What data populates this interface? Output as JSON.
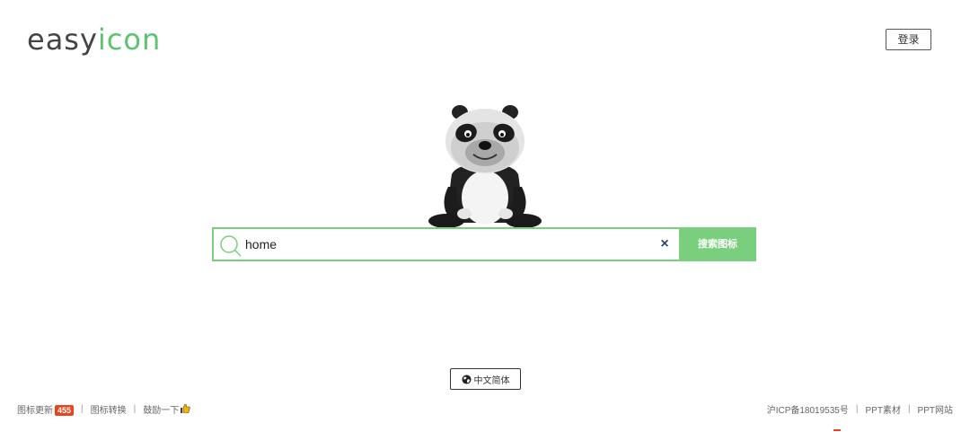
{
  "header": {
    "logo_part1": "easy",
    "logo_part2": "icon",
    "login_label": "登录"
  },
  "mascot": {
    "icon": "panda-mascot"
  },
  "search": {
    "query": "home",
    "clear_icon": "×",
    "button_label": "搜索图标"
  },
  "language": {
    "label": "中文简体",
    "icon": "globe-icon"
  },
  "footer": {
    "left": {
      "updates_label": "图标更新",
      "updates_count": "455",
      "sep": "|",
      "convert_label": "图标转换",
      "encourage_label": "鼓励一下"
    },
    "right": {
      "icp": "沪ICP备18019535号",
      "sep": "|",
      "ppt_material": "PPT素材",
      "ppt_site": "PPT网站"
    }
  },
  "colors": {
    "accent": "#79cf7d",
    "logo_green": "#5cc46c",
    "badge": "#e8441f"
  }
}
